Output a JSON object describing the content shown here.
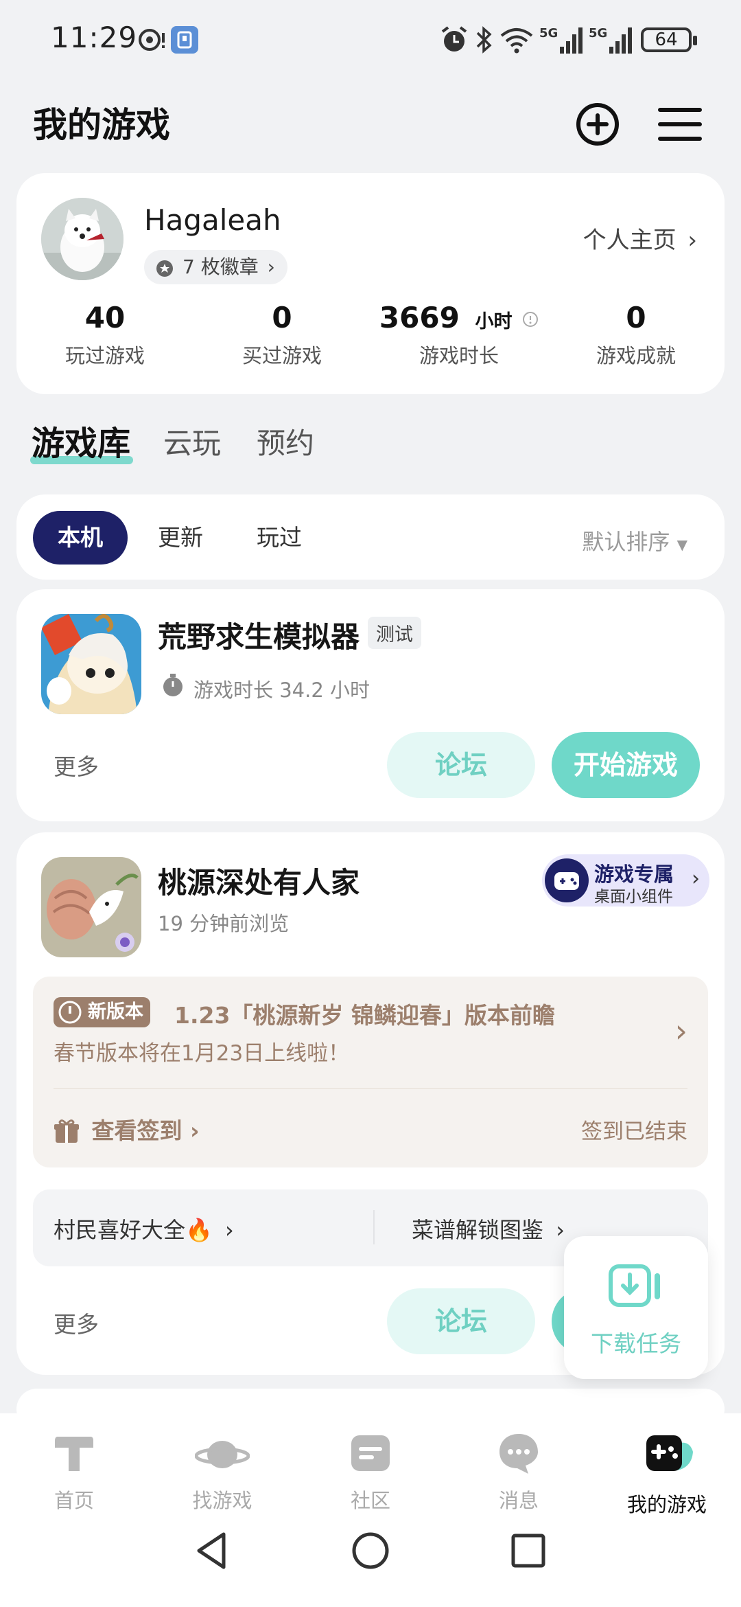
{
  "status_bar": {
    "time": "11:29",
    "battery": "64"
  },
  "header": {
    "title": "我的游戏"
  },
  "profile": {
    "username": "Hagaleah",
    "badge_label": "7 枚徽章",
    "homepage_label": "个人主页",
    "stats": [
      {
        "value": "40",
        "unit": "",
        "label": "玩过游戏"
      },
      {
        "value": "0",
        "unit": "",
        "label": "买过游戏"
      },
      {
        "value": "3669",
        "unit": "小时",
        "label": "游戏时长"
      },
      {
        "value": "0",
        "unit": "",
        "label": "游戏成就"
      }
    ]
  },
  "tabs": [
    "游戏库",
    "云玩",
    "预约"
  ],
  "filters": {
    "chips": [
      "本机",
      "更新",
      "玩过"
    ],
    "sort_label": "默认排序"
  },
  "game1": {
    "name": "荒野求生模拟器",
    "tag": "测试",
    "playtime": "游戏时长 34.2 小时",
    "more": "更多",
    "forum": "论坛",
    "start": "开始游戏"
  },
  "game2": {
    "name": "桃源深处有人家",
    "subtitle": "19 分钟前浏览",
    "widget_title": "游戏专属",
    "widget_sub": "桌面小组件",
    "notice_badge": "新版本",
    "notice_title": "1.23「桃源新岁 锦鳞迎春」版本前瞻",
    "notice_body": "春节版本将在1月23日上线啦！",
    "checkin": "查看签到",
    "checkin_status": "签到已结束",
    "link1": "村民喜好大全🔥",
    "link2": "菜谱解锁图鉴",
    "more": "更多",
    "forum": "论坛"
  },
  "download_float": {
    "label": "下载任务"
  },
  "bottom_nav": [
    "首页",
    "找游戏",
    "社区",
    "消息",
    "我的游戏"
  ],
  "colors": {
    "accent": "#6fd8c9",
    "accent_light": "#e4f8f5",
    "dark_chip": "#1e2167"
  }
}
